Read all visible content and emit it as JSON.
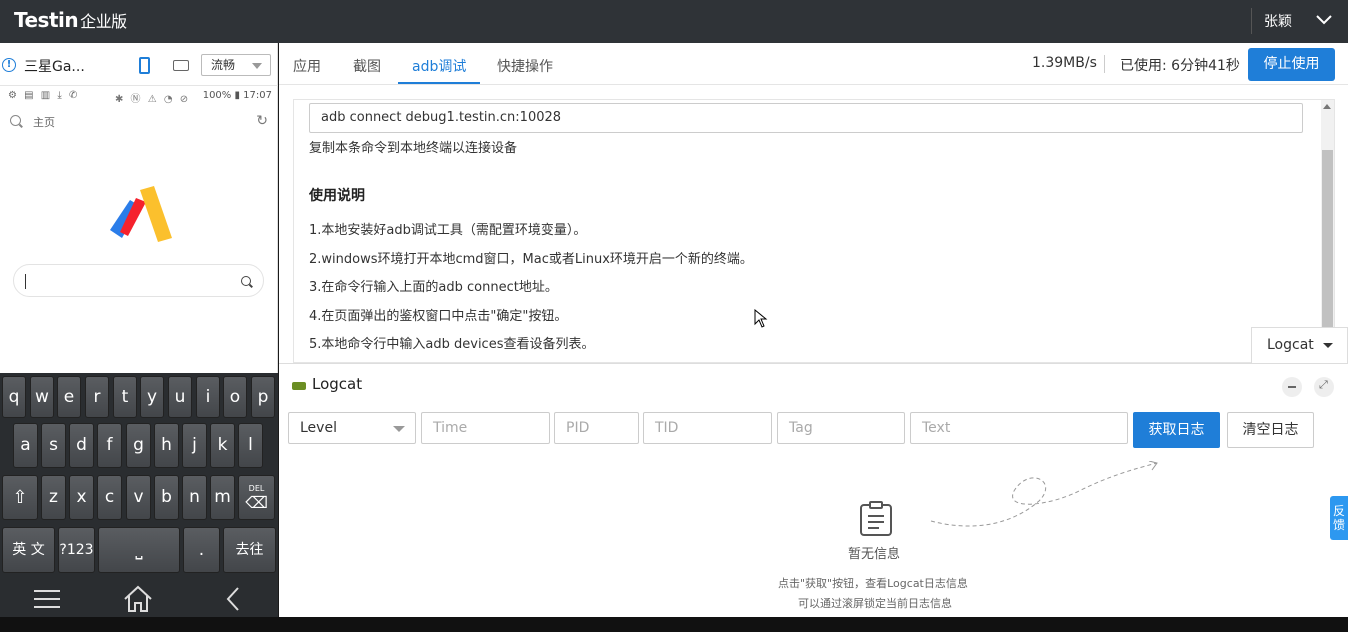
{
  "header": {
    "logo": "Testin",
    "logo_sub": "企业版",
    "user_name": "张颖"
  },
  "device": {
    "name": "三星Ga...",
    "quality": "流畅",
    "status_icons_left": "⚙ ▤ ▥ ⤓ ✆",
    "status_icons_mid": "✱ Ⓝ ⚠ ◔ ⊘",
    "battery": "100%",
    "time": "17:07",
    "browser_home": "主页",
    "keyboard": {
      "row1": [
        "q",
        "w",
        "e",
        "r",
        "t",
        "y",
        "u",
        "i",
        "o",
        "p"
      ],
      "row2": [
        "a",
        "s",
        "d",
        "f",
        "g",
        "h",
        "j",
        "k",
        "l"
      ],
      "row3": [
        "z",
        "x",
        "c",
        "v",
        "b",
        "n",
        "m"
      ],
      "del_label": "DEL",
      "lang": "英 文",
      "num": "?123",
      "space": "⎵",
      "dot": ".",
      "go": "去往"
    }
  },
  "tabs": [
    {
      "label": "应用",
      "active": false
    },
    {
      "label": "截图",
      "active": false
    },
    {
      "label": "adb调试",
      "active": true
    },
    {
      "label": "快捷操作",
      "active": false
    }
  ],
  "session": {
    "speed": "1.39MB/s",
    "used": "已使用: 6分钟41秒",
    "stop_button": "停止使用"
  },
  "adb": {
    "command": "adb connect debug1.testin.cn:10028",
    "hint": "复制本条命令到本地终端以连接设备",
    "usage_title": "使用说明",
    "steps": [
      "1.本地安装好adb调试工具（需配置环境变量）。",
      "2.windows环境打开本地cmd窗口，Mac或者Linux环境开启一个新的终端。",
      "3.在命令行输入上面的adb connect地址。",
      "4.在页面弹出的鉴权窗口中点击\"确定\"按钮。",
      "5.本地命令行中输入adb devices查看设备列表。"
    ]
  },
  "logcat": {
    "tab_label": "Logcat",
    "title": "Logcat",
    "level": "Level",
    "placeholders": {
      "time": "Time",
      "pid": "PID",
      "tid": "TID",
      "tag": "Tag",
      "text": "Text"
    },
    "get_button": "获取日志",
    "clear_button": "清空日志",
    "empty_text": "暂无信息",
    "empty_hint1": "点击\"获取\"按钮，查看Logcat日志信息",
    "empty_hint2": "可以通过滚屏锁定当前日志信息"
  },
  "feedback": "反馈",
  "colors": {
    "accent": "#1f7ed8",
    "header_bg": "#2f3337",
    "keyboard_bg": "#2a2d30"
  }
}
